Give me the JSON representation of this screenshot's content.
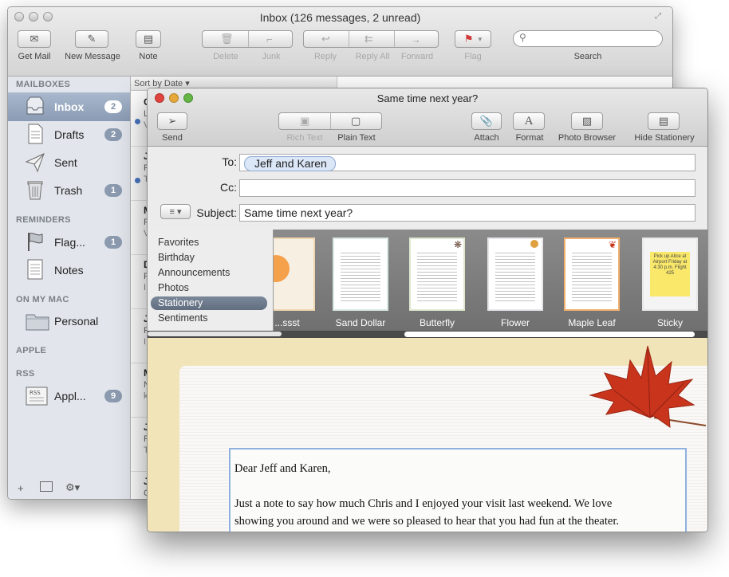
{
  "mail_window": {
    "title": "Inbox (126 messages, 2 unread)",
    "toolbar": {
      "get_mail": "Get Mail",
      "new_message": "New Message",
      "note": "Note",
      "delete": "Delete",
      "junk": "Junk",
      "reply": "Reply",
      "reply_all": "Reply All",
      "forward": "Forward",
      "flag": "Flag",
      "search_label": "Search",
      "search_placeholder": ""
    },
    "sidebar": {
      "mailboxes_header": "MAILBOXES",
      "inbox": {
        "label": "Inbox",
        "badge": "2"
      },
      "drafts": {
        "label": "Drafts",
        "badge": "2"
      },
      "sent": {
        "label": "Sent"
      },
      "trash": {
        "label": "Trash",
        "badge": "1"
      },
      "reminders_header": "REMINDERS",
      "flagged": {
        "label": "Flag...",
        "badge": "1"
      },
      "notes": {
        "label": "Notes"
      },
      "on_my_mac_header": "ON MY MAC",
      "personal": {
        "label": "Personal"
      },
      "apple_header": "APPLE",
      "rss_header": "RSS",
      "apple_rss": {
        "label": "Appl...",
        "badge": "9"
      },
      "bottom": {
        "add": "+",
        "gear": "⚙▾"
      }
    },
    "message_list": {
      "sort_label": "Sort by Date ▾",
      "rows": [
        {
          "l1": "C",
          "l2": "L",
          "l3": "V"
        },
        {
          "l1": "J",
          "l2": "F",
          "l3": "T"
        },
        {
          "l1": "M",
          "l2": "F",
          "l3": "V"
        },
        {
          "l1": "D",
          "l2": "F",
          "l3": "I"
        },
        {
          "l1": "J",
          "l2": "F",
          "l3": "I"
        },
        {
          "l1": "M",
          "l2": "N",
          "l3": "k"
        },
        {
          "l1": "J",
          "l2": "F",
          "l3": "T"
        },
        {
          "l1": "J",
          "l2": "C",
          "l3": "F"
        }
      ]
    }
  },
  "compose_window": {
    "title": "Same time next year?",
    "toolbar": {
      "send": "Send",
      "rich_text": "Rich Text",
      "plain_text": "Plain Text",
      "attach": "Attach",
      "format": "Format",
      "format_glyph": "A",
      "photo_browser": "Photo Browser",
      "hide_stationery": "Hide Stationery"
    },
    "headers": {
      "to_label": "To:",
      "to_token": "Jeff and Karen",
      "cc_label": "Cc:",
      "subject_label": "Subject:",
      "subject_value": "Same time next year?",
      "format_menu": "≡ ▾"
    },
    "stationery": {
      "categories": [
        "Favorites",
        "Birthday",
        "Announcements",
        "Photos",
        "Stationery",
        "Sentiments"
      ],
      "selected_category": "Stationery",
      "templates": [
        "...ssst",
        "Sand Dollar",
        "Butterfly",
        "Flower",
        "Maple Leaf",
        "Sticky"
      ],
      "sticky_note_text": "Pick up Alice at Airport Friday at 4:30 p.m. Flight 425"
    },
    "letter": {
      "greeting": "Dear Jeff and Karen,",
      "line1": "Just a note to say how much Chris and I enjoyed your visit last weekend. We love",
      "line2": "showing you around and we were so pleased to hear that you had fun at the theater."
    }
  },
  "colors": {
    "sidebar_bg": "#e2e6ec",
    "selection": "#8a9bb4",
    "close_red": "#e0443e",
    "minimize_yellow": "#e6a83a",
    "zoom_green": "#65b545",
    "paper": "#f2e4b9",
    "leaf": "#c8341c"
  }
}
